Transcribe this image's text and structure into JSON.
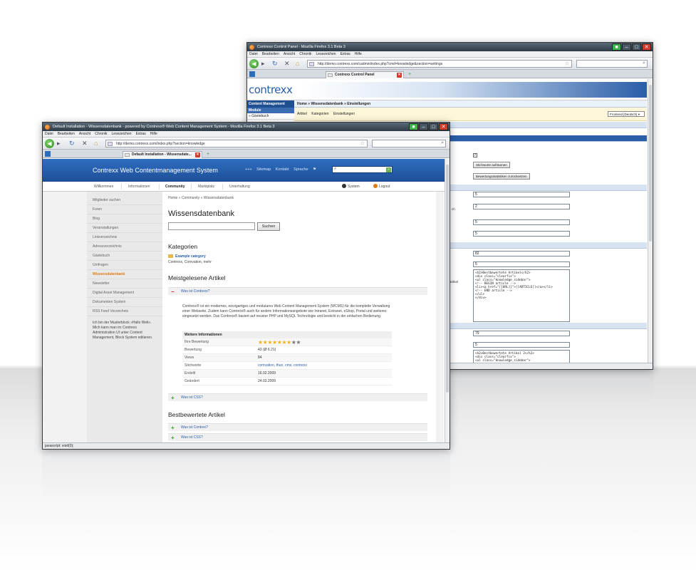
{
  "back_window": {
    "title": "Contrexx Control Panel - Mozilla Firefox 3.1 Beta 3",
    "menu": [
      "Datei",
      "Bearbeiten",
      "Ansicht",
      "Chronik",
      "Lesezeichen",
      "Extras",
      "Hilfe"
    ],
    "url": "http://demo.contrexx.com/cadmin/index.php?cmd=knowledge&section=settings",
    "tab_label": "Contrexx Control Panel",
    "logo": "contrexx",
    "sidebar": {
      "content_management": "Content Management",
      "module": "Module",
      "guestbook": "» Gästebuch"
    },
    "breadcrumb": "Home » Wissensdatenbank » Einstellungen",
    "subnav": [
      "Artikel",
      "Kategorien",
      "Einstellungen"
    ],
    "language_select": "Frontend [Deutsch]",
    "buttons": {
      "tags_button": "Stichworte aufräumen",
      "reset_button": "Bewertungsstatistiken zurücksetzen"
    },
    "side_labels": {
      "l1": "ch",
      "l2": "artikel"
    },
    "fields": [
      "5",
      "2",
      "5",
      "5",
      "82",
      "5",
      "79",
      "5"
    ],
    "checkbox": "✓",
    "template_most_read": "<h2>Bestbewertete Artikel</h2>\n<div class=\"clearfix\">\n<ul class=\"knowledge_sidebar\">\n<!-- BEGIN article -->\n<li><a href=\"[[URL]]\">[[ARTICLE]]</a></li>\n<!-- END article -->\n</ul>\n</div>",
    "template_best_rated": "<h2>Bestbewertete Artikel 2</h2>\n<div class=\"clearfix\">\n<ul class=\"knowledge_sidebar\">"
  },
  "front_window": {
    "title": "Default Installation - Wissensdatenbank - powered by Contrexx® Web Content Management System - Mozilla Firefox 3.1 Beta 3",
    "menu": [
      "Datei",
      "Bearbeiten",
      "Ansicht",
      "Chronik",
      "Lesezeichen",
      "Extras",
      "Hilfe"
    ],
    "url": "http://demo.contrexx.com/index.php?section=knowledge",
    "tab_label": "Default Installation - Wissensdate...",
    "site_title": "Contrexx Web Contentmanagement System",
    "header_links": [
      "+++",
      "Sitemap",
      "Kontakt",
      "Sprache"
    ],
    "nav": [
      "Willkommen",
      "Informationen",
      "Community",
      "Marktplatz",
      "Unterhaltung"
    ],
    "nav_active": "Community",
    "util_links": {
      "system": "System",
      "logout": "Logout"
    },
    "sidebar_items": [
      "Mitglieder suchen",
      "Foren",
      "Blog",
      "Veranstaltungen",
      "Linkverzeichnis",
      "Adressverzeichnis",
      "Gästebuch",
      "Umfragen",
      "Wissensdatenbank",
      "Newsletter",
      "Digital Asset Management",
      "Dokumenten System",
      "RSS Feed Verzeichnis"
    ],
    "sidebar_active": "Wissensdatenbank",
    "sidebar_note": "Ich bin der Musterblock »Hallo Welt«. Mich kann man im Contrexx Administration UI unter Content Management, Block System editieren.",
    "breadcrumb": "Home » Community » Wissensdatenbank",
    "heading": "Wissensdatenbank",
    "search_button": "Suchen",
    "categories_heading": "Kategorien",
    "category_title": "Example category",
    "category_sub": "Contrexx, Comvation, mehr",
    "most_read_heading": "Meistgelesene Artikel",
    "article1": "Was ist Contrexx?",
    "article1_text": "Contrexx® ist ein modernes, einzigartiges und modulares Web Content Management System (WCMS) für die komplette Verwaltung einer Webseite. Zudem kann Contrexx® auch für andere Informationsangebote wie Intranet, Extranet, eShop, Portal und weiteres eingesetzt werden. Das Contrexx® basiert auf neuster PHP und MySQL Technologie und besticht in der einfachen Bedienung.",
    "info_heading": "Weitere Informationen",
    "info": [
      {
        "k": "Ihre Bewertung",
        "v": ""
      },
      {
        "k": "Bewertung",
        "v": "43 (Ø 6.21)"
      },
      {
        "k": "Views",
        "v": "84"
      },
      {
        "k": "Stichworte",
        "v": "comvation, thun, cms, contrexx"
      },
      {
        "k": "Erstellt",
        "v": "16.02.2009"
      },
      {
        "k": "Geändert",
        "v": "24.03.2009"
      }
    ],
    "rating": {
      "filled": 7,
      "total": 9
    },
    "article2": "Was ist CSS?",
    "best_rated_heading": "Bestbewertete Artikel",
    "best1": "Was ist Contrex?",
    "best2": "Was ist CSS?",
    "status": "javascript: void(0);"
  },
  "colors": {
    "brand_blue": "#2f6ec0",
    "active_orange": "#e07b18",
    "star": "#f0b21a"
  }
}
